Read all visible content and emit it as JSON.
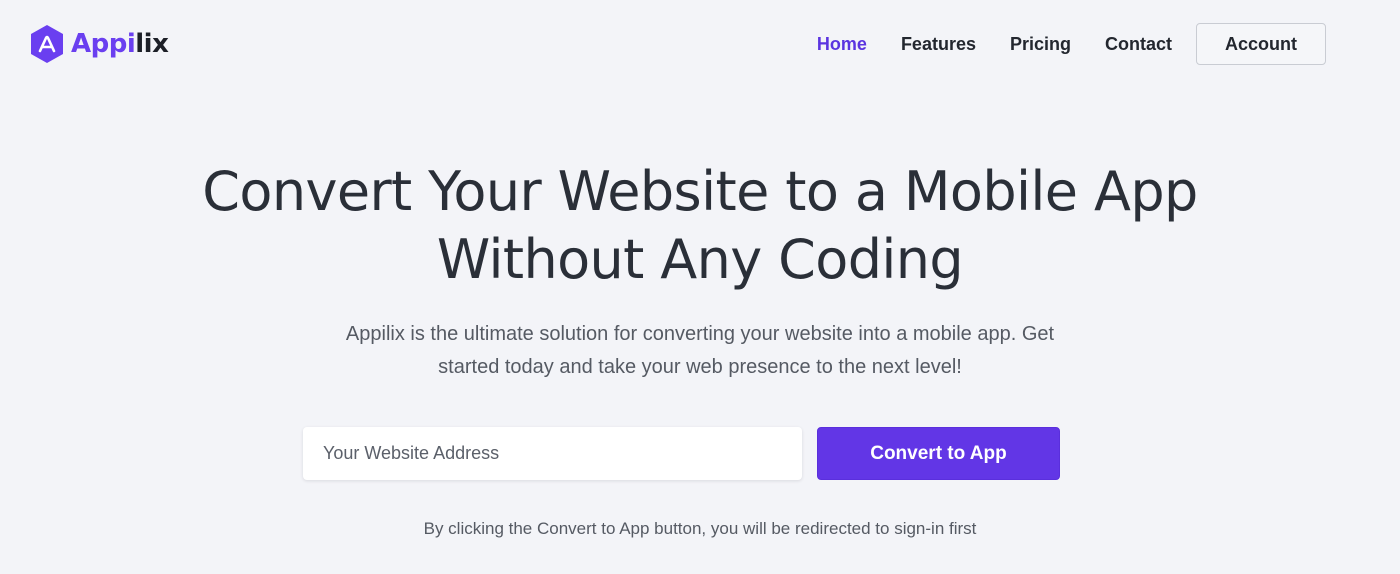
{
  "brand": {
    "name_part1": "Appi",
    "name_part2": "lix",
    "logo_icon": "appilix-hexagon-icon",
    "accent_color": "#6236e6"
  },
  "nav": {
    "links": [
      {
        "label": "Home",
        "active": true
      },
      {
        "label": "Features",
        "active": false
      },
      {
        "label": "Pricing",
        "active": false
      },
      {
        "label": "Contact",
        "active": false
      }
    ],
    "account_label": "Account"
  },
  "hero": {
    "headline_line1": "Convert Your Website to a Mobile App",
    "headline_line2": "Without Any Coding",
    "subtitle_line1": "Appilix is the ultimate solution for converting your website into a mobile app. Get",
    "subtitle_line2": "started today and take your web presence to the next level!",
    "input_placeholder": "Your Website Address",
    "input_value": "",
    "button_label": "Convert to App",
    "disclaimer": "By clicking the Convert to App button, you will be redirected to sign-in first"
  }
}
